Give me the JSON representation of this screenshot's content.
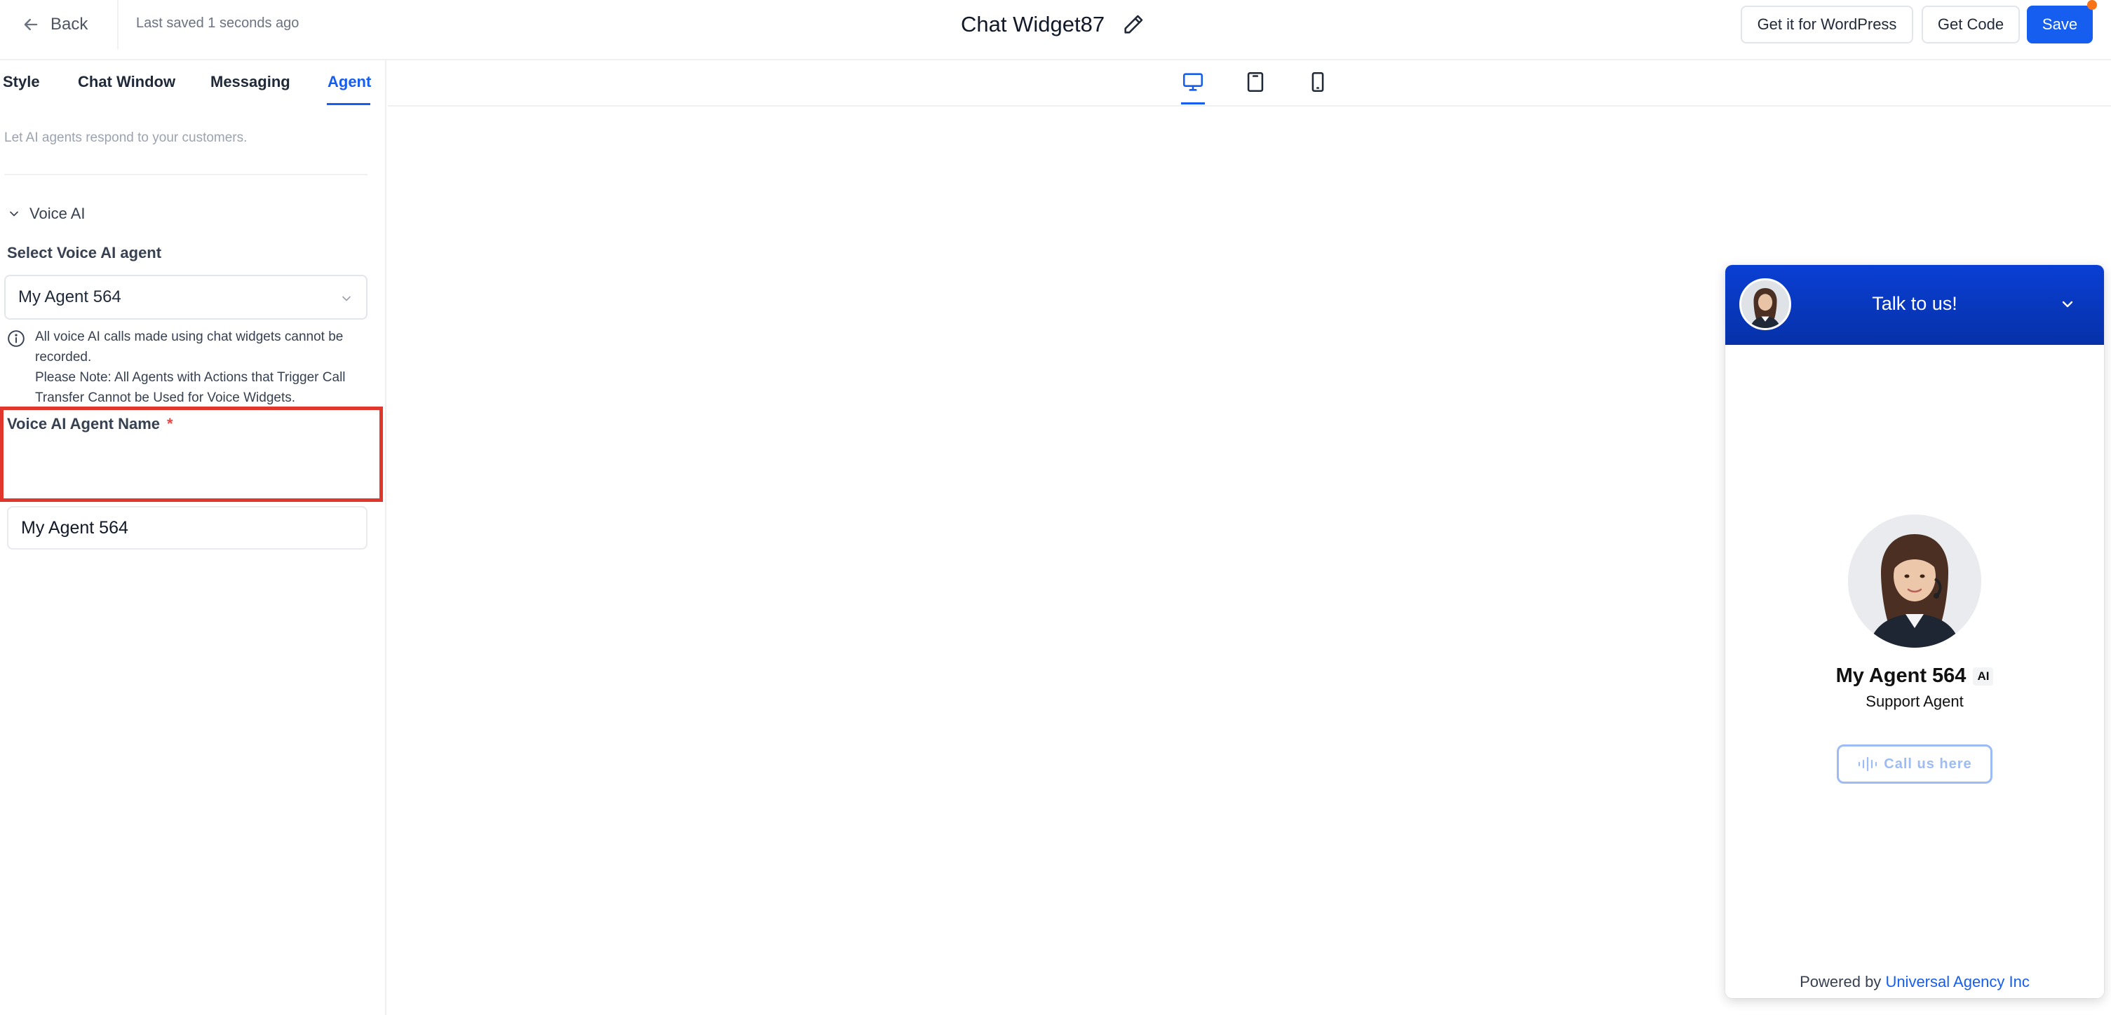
{
  "header": {
    "back_label": "Back",
    "saved_status": "Last saved 1 seconds ago",
    "title": "Chat Widget87",
    "buttons": {
      "wordpress": "Get it for WordPress",
      "get_code": "Get Code",
      "save": "Save"
    }
  },
  "sidebar": {
    "tabs": [
      "Style",
      "Chat Window",
      "Messaging",
      "Agent"
    ],
    "active_tab": "Agent",
    "hint": "Let AI agents respond to your customers.",
    "section_title": "Voice AI",
    "select_label": "Select Voice AI agent",
    "select_value": "My Agent 564",
    "info_lines": [
      "All voice AI calls made using chat widgets cannot be recorded.",
      "Please Note: All Agents with Actions that Trigger Call Transfer Cannot be Used for Voice Widgets."
    ],
    "name_label": "Voice AI Agent Name",
    "name_required": "*",
    "name_value": "My Agent 564"
  },
  "preview": {
    "devices": [
      "desktop-icon",
      "tablet-icon",
      "mobile-icon"
    ],
    "active_device": "desktop-icon"
  },
  "widget": {
    "header_title": "Talk to us!",
    "agent_name": "My Agent 564",
    "ai_badge": "AI",
    "agent_role": "Support Agent",
    "call_button": "Call us here",
    "footer_prefix": "Powered by",
    "footer_link": "Universal Agency Inc"
  },
  "colors": {
    "accent": "#155eef",
    "widget_header": "#0a3fd4",
    "highlight": "#e0362c",
    "notification_dot": "#f97316"
  }
}
